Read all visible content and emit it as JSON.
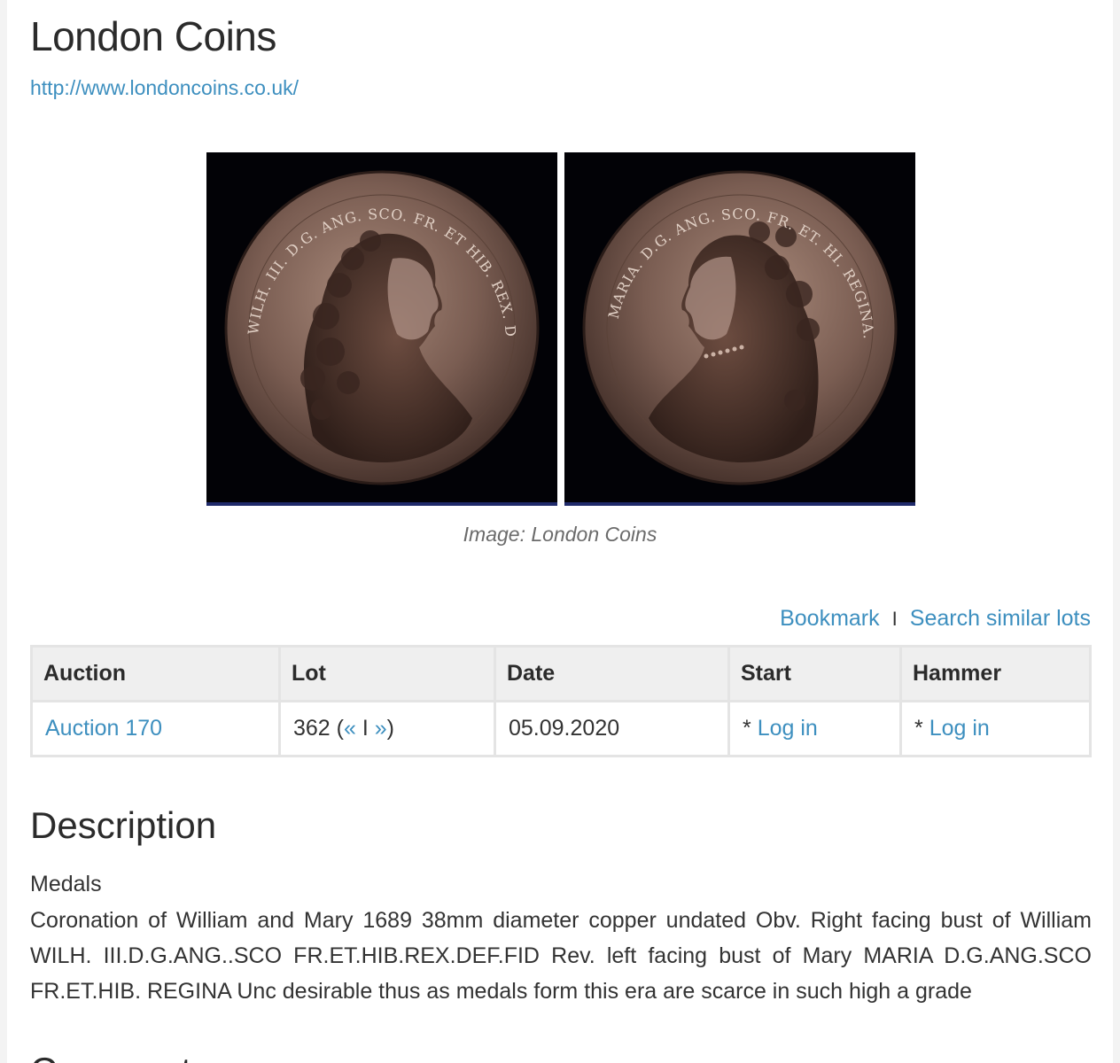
{
  "dealer": {
    "name": "London Coins",
    "url": "http://www.londoncoins.co.uk/"
  },
  "image": {
    "caption": "Image: London Coins",
    "obverse_legend": "WILH. III. D.G. ANG. SCO. FR. ET HIB. REX. DEF. FID.",
    "reverse_legend": "MARIA. D.G. ANG. SCO. FR. ET. HI. REGINA."
  },
  "actions": {
    "bookmark": "Bookmark",
    "separator": "I",
    "search_similar": "Search similar lots"
  },
  "table": {
    "headers": {
      "auction": "Auction",
      "lot": "Lot",
      "date": "Date",
      "start": "Start",
      "hammer": "Hammer"
    },
    "row": {
      "auction": "Auction 170",
      "lot_number": "362",
      "lot_open": " (",
      "prev": "«",
      "lot_sep": " I ",
      "next": "»",
      "lot_close": ")",
      "date": "05.09.2020",
      "start_prefix": "* ",
      "start_link": "Log in",
      "hammer_prefix": "* ",
      "hammer_link": "Log in"
    }
  },
  "description": {
    "title": "Description",
    "category": "Medals",
    "text": "Coronation of William and Mary 1689 38mm diameter copper undated Obv. Right facing bust of William WILH. III.D.G.ANG..SCO FR.ET.HIB.REX.DEF.FID Rev. left facing bust of Mary MARIA D.G.ANG.SCO FR.ET.HIB. REGINA Unc desirable thus as medals form this era are scarce in such high a grade"
  },
  "next_section": {
    "title_partial": "Comments"
  }
}
